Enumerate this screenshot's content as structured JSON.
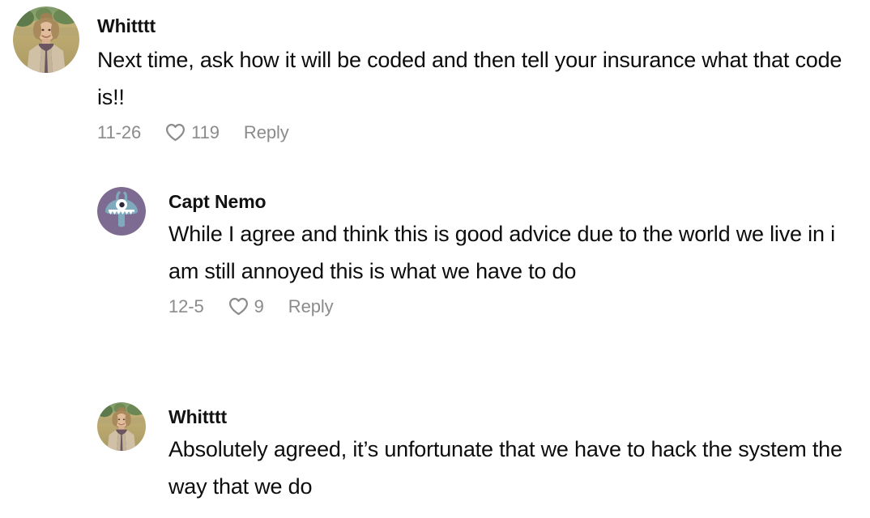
{
  "theme": {
    "background": "#ffffff",
    "text_primary": "#0d0d0d",
    "text_meta": "#8b8b8b",
    "avatar_purple": "#7d6b91",
    "avatar_teal": "#7fa9bd"
  },
  "comments": [
    {
      "id": "comment-1",
      "username": "Whitttt",
      "avatar": "photo-woman-outdoors",
      "text": "Next time, ask how it will be coded and then tell your insurance what that code is!!",
      "date": "11-26",
      "like_icon": "heart-icon",
      "likes": "119",
      "reply_label": "Reply",
      "depth": 0
    },
    {
      "id": "comment-2",
      "username": "Capt Nemo",
      "avatar": "cartoon-monster-purple",
      "text": "While I agree and think this is good advice due to the world we live in i am still annoyed this is what we have to do",
      "date": "12-5",
      "like_icon": "heart-icon",
      "likes": "9",
      "reply_label": "Reply",
      "depth": 1
    },
    {
      "id": "comment-3",
      "username": "Whitttt",
      "avatar": "photo-woman-outdoors",
      "text": "Absolutely agreed, it’s unfortunate that we have to hack the system the way that we do",
      "depth": 1
    }
  ]
}
